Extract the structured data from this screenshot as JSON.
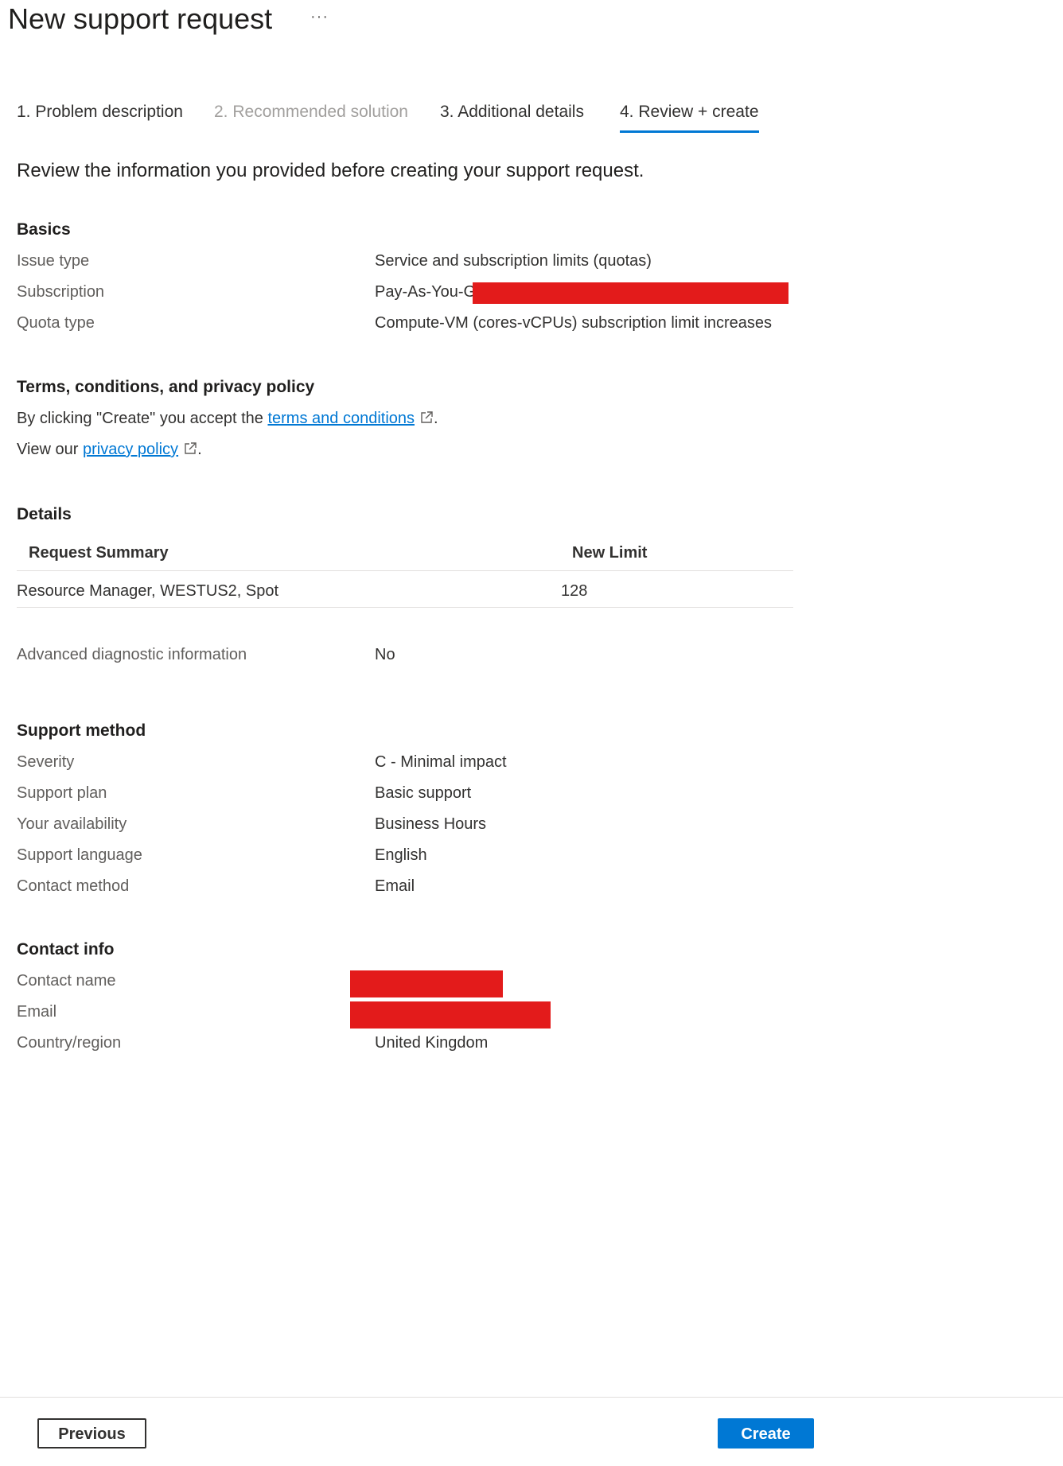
{
  "header": {
    "title": "New support request",
    "more_label": "···"
  },
  "tabs": [
    {
      "label": "1. Problem description",
      "state": "completed"
    },
    {
      "label": "2. Recommended solution",
      "state": "disabled"
    },
    {
      "label": "3. Additional details",
      "state": "completed"
    },
    {
      "label": "4. Review + create",
      "state": "active"
    }
  ],
  "intro": "Review the information you provided before creating your support request.",
  "basics": {
    "title": "Basics",
    "rows": [
      {
        "label": "Issue type",
        "value": "Service and subscription limits (quotas)"
      },
      {
        "label": "Subscription",
        "value": "Pay-As-You-Go"
      },
      {
        "label": "Quota type",
        "value": "Compute-VM (cores-vCPUs) subscription limit increases"
      }
    ]
  },
  "terms": {
    "title": "Terms, conditions, and privacy policy",
    "line1_prefix": "By clicking \"Create\" you accept the ",
    "line1_link": "terms and conditions",
    "line1_suffix": ".",
    "line2_prefix": "View our ",
    "line2_link": "privacy policy",
    "line2_suffix": "."
  },
  "details": {
    "title": "Details",
    "columns": [
      "Request Summary",
      "New Limit"
    ],
    "rows": [
      {
        "summary": "Resource Manager, WESTUS2, Spot",
        "limit": "128"
      }
    ],
    "advanced_label": "Advanced diagnostic information",
    "advanced_value": "No"
  },
  "support_method": {
    "title": "Support method",
    "rows": [
      {
        "label": "Severity",
        "value": "C - Minimal impact"
      },
      {
        "label": "Support plan",
        "value": "Basic support"
      },
      {
        "label": "Your availability",
        "value": "Business Hours"
      },
      {
        "label": "Support language",
        "value": "English"
      },
      {
        "label": "Contact method",
        "value": "Email"
      }
    ]
  },
  "contact_info": {
    "title": "Contact info",
    "rows": [
      {
        "label": "Contact name",
        "value": ""
      },
      {
        "label": "Email",
        "value": ""
      },
      {
        "label": "Country/region",
        "value": "United Kingdom"
      }
    ]
  },
  "footer": {
    "previous_label": "Previous",
    "create_label": "Create"
  },
  "colors": {
    "accent": "#0078d4",
    "redaction": "#e31b1b",
    "text": "#323130",
    "muted": "#605e5c",
    "disabled": "#a19f9d"
  }
}
